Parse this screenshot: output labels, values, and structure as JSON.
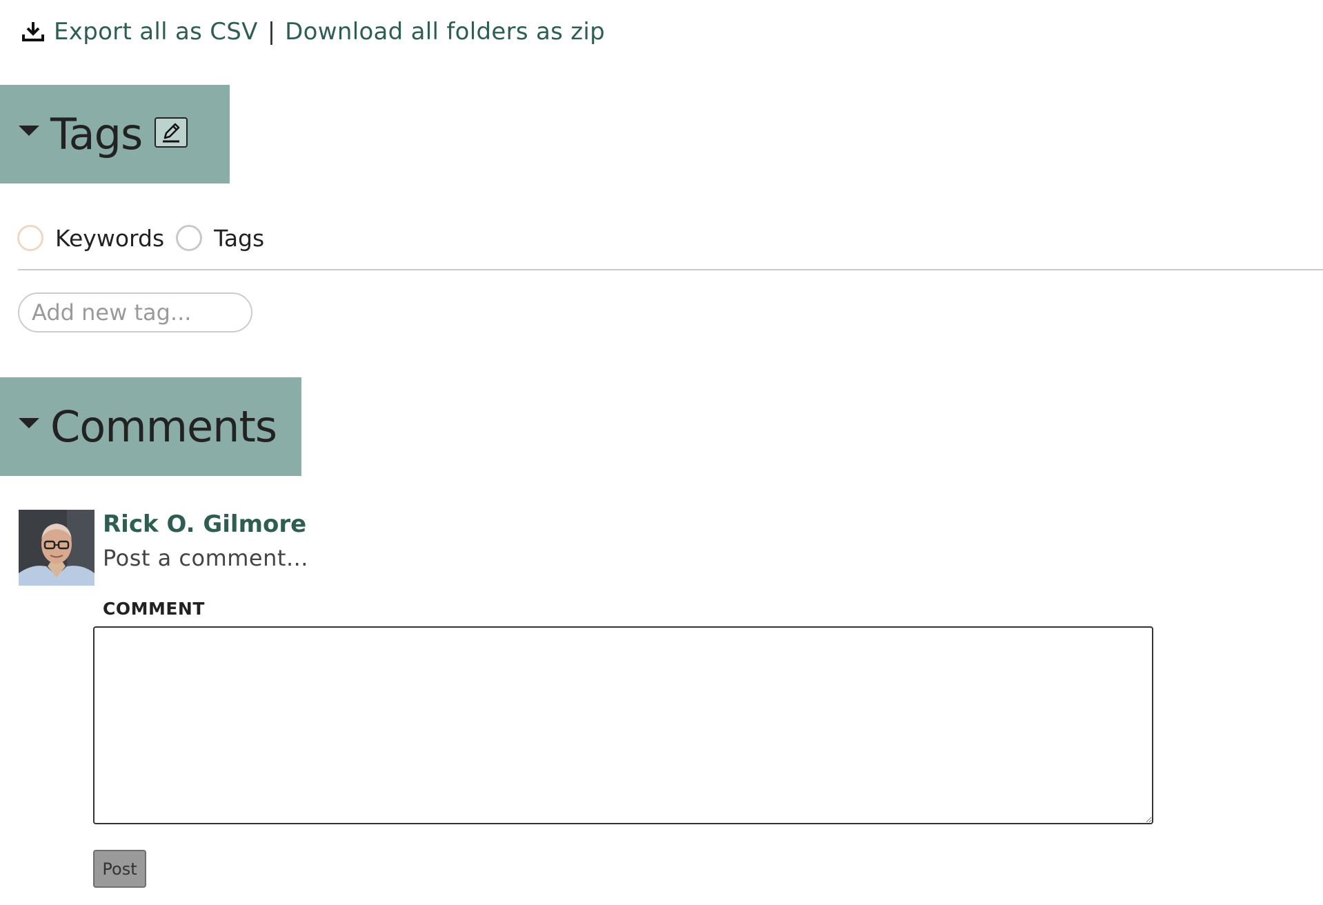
{
  "export": {
    "csv_link": "Export all as CSV",
    "separator": "|",
    "zip_link": "Download all folders as zip",
    "icon": "download-icon"
  },
  "tags_section": {
    "title": "Tags",
    "expanded": true,
    "edit_icon": "pencil-icon",
    "radio_options": [
      {
        "label": "Keywords",
        "selected": false
      },
      {
        "label": "Tags",
        "selected": false
      }
    ],
    "input_placeholder": "Add new tag..."
  },
  "comments_section": {
    "title": "Comments",
    "expanded": true,
    "user_name": "Rick O. Gilmore",
    "prompt": "Post a comment...",
    "comment_label": "COMMENT",
    "comment_value": "",
    "post_button": "Post"
  },
  "colors": {
    "section_header_bg": "#8aaea7",
    "link": "#2e5d52",
    "post_button_bg": "#9a9a9a"
  }
}
